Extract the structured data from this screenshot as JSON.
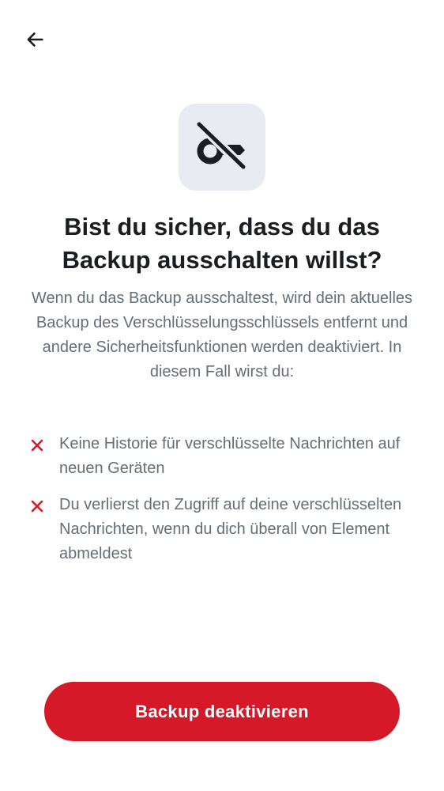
{
  "icons": {
    "back": "arrow-left-icon",
    "hero": "key-off-icon",
    "consequence": "close-icon"
  },
  "colors": {
    "accent": "#d51928",
    "hero_background": "#e8ebf1",
    "title": "#1b1d22",
    "body_text": "#656d77"
  },
  "title": "Bist du sicher, dass du das Backup ausschalten willst?",
  "description": "Wenn du das Backup ausschaltest, wird dein aktuelles Backup des Verschlüsselungsschlüssels entfernt und andere Sicherheitsfunktionen werden deaktiviert. In diesem Fall wirst du:",
  "consequences": [
    "Keine Historie für verschlüsselte Nachrichten auf neuen Geräten",
    "Du verlierst den Zugriff auf deine verschlüsselten Nachrichten, wenn du dich überall von Element abmeldest"
  ],
  "primary_button": "Backup deaktivieren"
}
